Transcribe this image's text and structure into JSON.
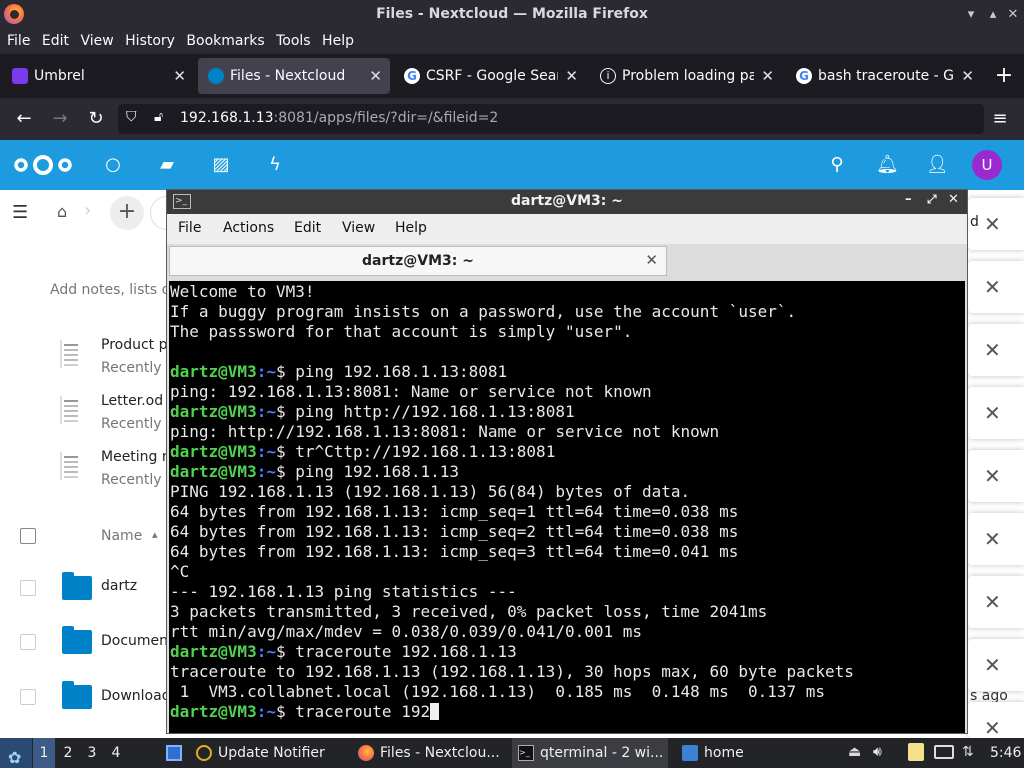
{
  "browser": {
    "window_title": "Files - Nextcloud — Mozilla Firefox",
    "menu": [
      "File",
      "Edit",
      "View",
      "History",
      "Bookmarks",
      "Tools",
      "Help"
    ],
    "tabs": [
      {
        "label": "Umbrel",
        "icon": "umbrel-icon",
        "color": "#7c3aed"
      },
      {
        "label": "Files - Nextcloud",
        "icon": "nextcloud-icon",
        "color": "#0082c9"
      },
      {
        "label": "CSRF - Google Search",
        "icon": "google-icon",
        "color": "#4285f4"
      },
      {
        "label": "Problem loading page",
        "icon": "info-icon",
        "color": "#fbfbfe"
      },
      {
        "label": "bash traceroute - Google Search",
        "icon": "google-icon",
        "color": "#4285f4"
      }
    ],
    "url_host": "192.168.1.13",
    "url_rest": ":8081/apps/files/?dir=/&fileid=2"
  },
  "nextcloud": {
    "avatar_letter": "U",
    "notes_placeholder": "Add notes, lists o",
    "recent": [
      {
        "name": "Product p",
        "sub": "Recently"
      },
      {
        "name": "Letter.od",
        "sub": "Recently"
      },
      {
        "name": "Meeting n",
        "sub": "Recently"
      }
    ],
    "column_name": "Name",
    "sort_arrow": "▴",
    "files": [
      "dartz",
      "Documen",
      "Download"
    ],
    "notif_fragment": "d",
    "time_fragment": "s ago"
  },
  "terminal": {
    "window_title": "dartz@VM3: ~",
    "menu": [
      "File",
      "Actions",
      "Edit",
      "View",
      "Help"
    ],
    "tab_label": "dartz@VM3: ~",
    "prompt_user": "dartz@VM3",
    "prompt_path": "~",
    "lines": [
      {
        "t": "out",
        "text": "Welcome to VM3!"
      },
      {
        "t": "out",
        "text": "If a buggy program insists on a password, use the account `user`."
      },
      {
        "t": "out",
        "text": "The passsword for that account is simply \"user\"."
      },
      {
        "t": "out",
        "text": ""
      },
      {
        "t": "cmd",
        "text": "ping 192.168.1.13:8081"
      },
      {
        "t": "out",
        "text": "ping: 192.168.1.13:8081: Name or service not known"
      },
      {
        "t": "cmd",
        "text": "ping http://192.168.1.13:8081"
      },
      {
        "t": "out",
        "text": "ping: http://192.168.1.13:8081: Name or service not known"
      },
      {
        "t": "cmd",
        "text": "tr^Cttp://192.168.1.13:8081"
      },
      {
        "t": "cmd",
        "text": "ping 192.168.1.13"
      },
      {
        "t": "out",
        "text": "PING 192.168.1.13 (192.168.1.13) 56(84) bytes of data."
      },
      {
        "t": "out",
        "text": "64 bytes from 192.168.1.13: icmp_seq=1 ttl=64 time=0.038 ms"
      },
      {
        "t": "out",
        "text": "64 bytes from 192.168.1.13: icmp_seq=2 ttl=64 time=0.038 ms"
      },
      {
        "t": "out",
        "text": "64 bytes from 192.168.1.13: icmp_seq=3 ttl=64 time=0.041 ms"
      },
      {
        "t": "out",
        "text": "^C"
      },
      {
        "t": "out",
        "text": "--- 192.168.1.13 ping statistics ---"
      },
      {
        "t": "out",
        "text": "3 packets transmitted, 3 received, 0% packet loss, time 2041ms"
      },
      {
        "t": "out",
        "text": "rtt min/avg/max/mdev = 0.038/0.039/0.041/0.001 ms"
      },
      {
        "t": "cmd",
        "text": "traceroute 192.168.1.13"
      },
      {
        "t": "out",
        "text": "traceroute to 192.168.1.13 (192.168.1.13), 30 hops max, 60 byte packets"
      },
      {
        "t": "out",
        "text": " 1  VM3.collabnet.local (192.168.1.13)  0.185 ms  0.148 ms  0.137 ms"
      },
      {
        "t": "cur",
        "text": "traceroute 192"
      }
    ]
  },
  "taskbar": {
    "workspaces": [
      "1",
      "2",
      "3",
      "4"
    ],
    "active_workspace": "1",
    "apps": [
      {
        "label": "Update Notifier",
        "icon": "update-notifier-icon"
      },
      {
        "label": "Files - Nextclou...",
        "icon": "firefox-icon"
      },
      {
        "label": "qterminal - 2 wi...",
        "icon": "terminal-icon"
      },
      {
        "label": "home",
        "icon": "folder-icon"
      }
    ],
    "clock": "5:46"
  }
}
